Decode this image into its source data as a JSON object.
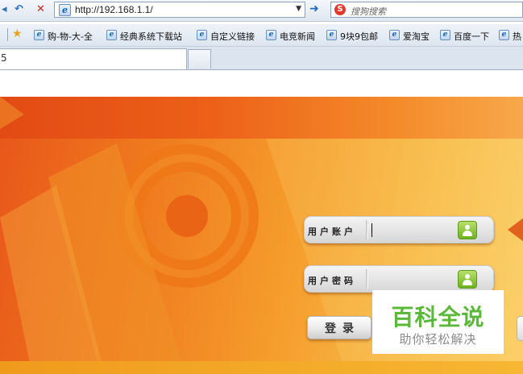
{
  "toolbar": {
    "back_icon": "back-refresh-icon",
    "stop_icon": "stop-icon",
    "address": "http://192.168.1.1/",
    "search_placeholder": "搜狗搜索",
    "search_engine_glyph": "S"
  },
  "favorites": {
    "items": [
      {
        "label": "购-物-大-全"
      },
      {
        "label": "经典系统下载站"
      },
      {
        "label": "自定义链接"
      },
      {
        "label": "电竞新闻"
      },
      {
        "label": "9块9包邮"
      },
      {
        "label": "爱淘宝"
      },
      {
        "label": "百度一下"
      },
      {
        "label": "热"
      }
    ]
  },
  "tabs": {
    "active_fragment": "5"
  },
  "login": {
    "username_label": "用户账户",
    "password_label": "用户密码",
    "login_button": "登录"
  },
  "watermark": {
    "title": "百科全说",
    "subtitle": "助你轻松解决"
  },
  "colors": {
    "banner_orange": "#ef7a1e",
    "banner_yellow": "#fbd06a",
    "user_icon_green": "#6fb21f",
    "watermark_green": "#5cb83a"
  }
}
